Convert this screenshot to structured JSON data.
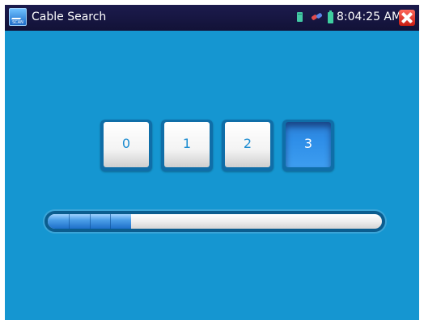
{
  "header": {
    "title": "Cable Search",
    "app_icon_text": "SCAN",
    "time": "8:04:25 AM",
    "status_icons": [
      "sd-card-icon",
      "link-icon",
      "battery-icon"
    ],
    "close_icon": "close-icon"
  },
  "channels": {
    "items": [
      {
        "label": "0",
        "active": false
      },
      {
        "label": "1",
        "active": false
      },
      {
        "label": "2",
        "active": false
      },
      {
        "label": "3",
        "active": true
      }
    ]
  },
  "progress": {
    "fraction": 0.25,
    "segments": 4
  },
  "colors": {
    "background": "#1596d1",
    "titlebar": "#1c1b4d",
    "key_text": "#1a8bd0",
    "active_key": "#2e8ee8",
    "close": "#e0392d"
  }
}
